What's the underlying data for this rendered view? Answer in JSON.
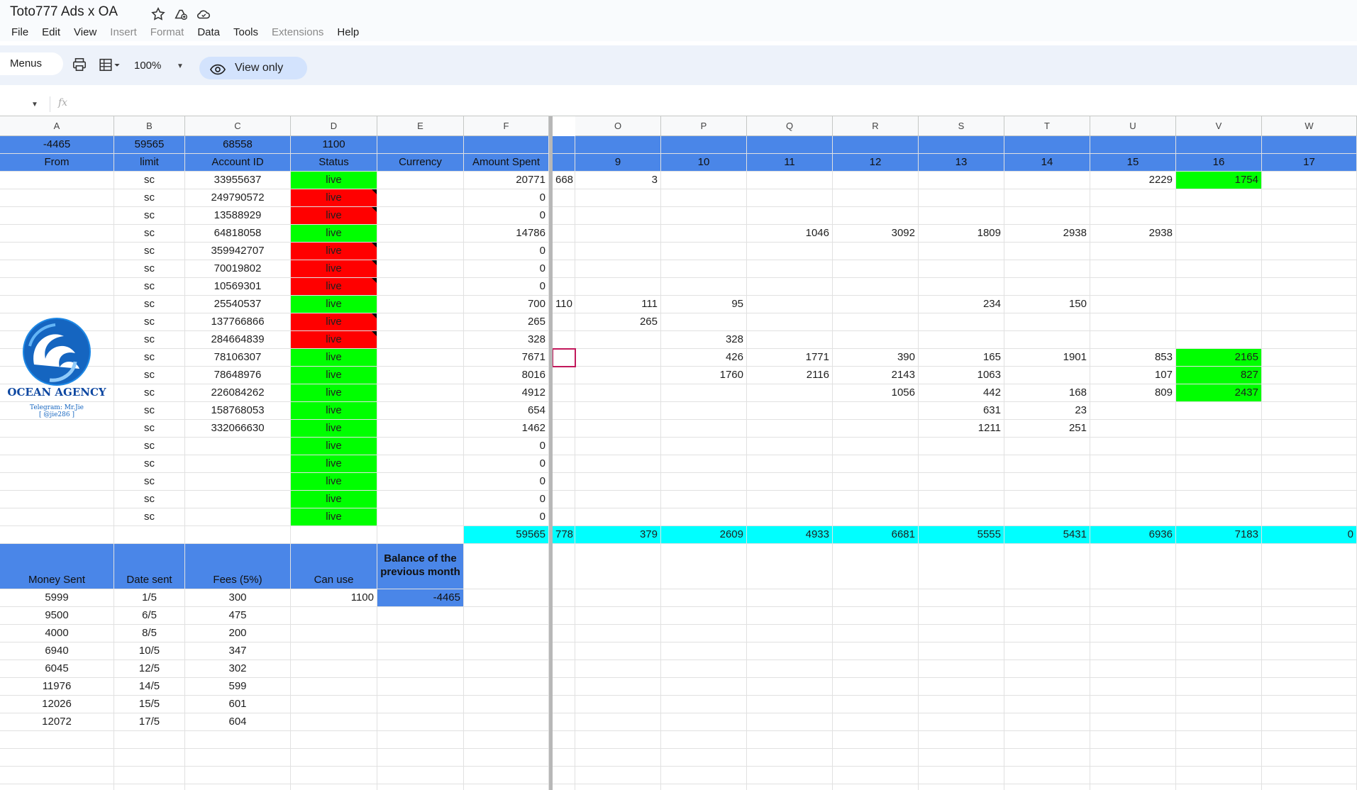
{
  "title": "Toto777 Ads x OA",
  "menus": [
    "File",
    "Edit",
    "View",
    "Insert",
    "Format",
    "Data",
    "Tools",
    "Extensions",
    "Help"
  ],
  "menus_disabled": [
    "Insert",
    "Format",
    "Extensions"
  ],
  "toolbar": {
    "menus_label": "Menus",
    "zoom": "100%",
    "view_only": "View only"
  },
  "formula_bar": {
    "fx": "fx",
    "value": ""
  },
  "columns": [
    "A",
    "B",
    "C",
    "D",
    "E",
    "F",
    "O",
    "P",
    "Q",
    "R",
    "S",
    "T",
    "U",
    "V",
    "W"
  ],
  "summary_row": [
    "-4465",
    "59565",
    "68558",
    "1100",
    "",
    ""
  ],
  "header_row": {
    "left": [
      "From",
      "limit",
      "Account ID",
      "Status",
      "Currency",
      "Amount Spent"
    ],
    "days": [
      "",
      "9",
      "10",
      "11",
      "12",
      "13",
      "14",
      "15",
      "16",
      "17"
    ]
  },
  "accounts": [
    {
      "limit": "sc",
      "id": "33955637",
      "status": "live",
      "status_color": "#00ff00",
      "spent": "20771",
      "n": "668",
      "days": [
        "3",
        "",
        "",
        "",
        "",
        "",
        "2229",
        "1754",
        ""
      ]
    },
    {
      "limit": "sc",
      "id": "249790572",
      "status": "live",
      "status_color": "#ff0000",
      "spent": "0",
      "n": "",
      "days": [
        "",
        "",
        "",
        "",
        "",
        "",
        "",
        "",
        ""
      ]
    },
    {
      "limit": "sc",
      "id": "13588929",
      "status": "live",
      "status_color": "#ff0000",
      "spent": "0",
      "n": "",
      "days": [
        "",
        "",
        "",
        "",
        "",
        "",
        "",
        "",
        ""
      ]
    },
    {
      "limit": "sc",
      "id": "64818058",
      "status": "live",
      "status_color": "#00ff00",
      "spent": "14786",
      "n": "",
      "days": [
        "",
        "",
        "1046",
        "3092",
        "1809",
        "2938",
        "2938",
        "",
        ""
      ]
    },
    {
      "limit": "sc",
      "id": "359942707",
      "status": "live",
      "status_color": "#ff0000",
      "spent": "0",
      "n": "",
      "days": [
        "",
        "",
        "",
        "",
        "",
        "",
        "",
        "",
        ""
      ]
    },
    {
      "limit": "sc",
      "id": "70019802",
      "status": "live",
      "status_color": "#ff0000",
      "spent": "0",
      "n": "",
      "days": [
        "",
        "",
        "",
        "",
        "",
        "",
        "",
        "",
        ""
      ]
    },
    {
      "limit": "sc",
      "id": "10569301",
      "status": "live",
      "status_color": "#ff0000",
      "spent": "0",
      "n": "",
      "days": [
        "",
        "",
        "",
        "",
        "",
        "",
        "",
        "",
        ""
      ]
    },
    {
      "limit": "sc",
      "id": "25540537",
      "status": "live",
      "status_color": "#00ff00",
      "spent": "700",
      "n": "110",
      "days": [
        "111",
        "95",
        "",
        "",
        "234",
        "150",
        "",
        "",
        ""
      ]
    },
    {
      "limit": "sc",
      "id": "137766866",
      "status": "live",
      "status_color": "#ff0000",
      "spent": "265",
      "n": "",
      "days": [
        "265",
        "",
        "",
        "",
        "",
        "",
        "",
        "",
        ""
      ]
    },
    {
      "limit": "sc",
      "id": "284664839",
      "status": "live",
      "status_color": "#ff0000",
      "spent": "328",
      "n": "",
      "days": [
        "",
        "328",
        "",
        "",
        "",
        "",
        "",
        "",
        ""
      ]
    },
    {
      "limit": "sc",
      "id": "78106307",
      "status": "live",
      "status_color": "#00ff00",
      "spent": "7671",
      "n": "",
      "days": [
        "",
        "426",
        "1771",
        "390",
        "165",
        "1901",
        "853",
        "2165",
        ""
      ]
    },
    {
      "limit": "sc",
      "id": "78648976",
      "status": "live",
      "status_color": "#00ff00",
      "spent": "8016",
      "n": "",
      "days": [
        "",
        "1760",
        "2116",
        "2143",
        "1063",
        "",
        "107",
        "827",
        ""
      ]
    },
    {
      "limit": "sc",
      "id": "226084262",
      "status": "live",
      "status_color": "#00ff00",
      "spent": "4912",
      "n": "",
      "days": [
        "",
        "",
        "",
        "1056",
        "442",
        "168",
        "809",
        "2437",
        ""
      ]
    },
    {
      "limit": "sc",
      "id": "158768053",
      "status": "live",
      "status_color": "#00ff00",
      "spent": "654",
      "n": "",
      "days": [
        "",
        "",
        "",
        "",
        "631",
        "23",
        "",
        "",
        ""
      ]
    },
    {
      "limit": "sc",
      "id": "332066630",
      "status": "live",
      "status_color": "#00ff00",
      "spent": "1462",
      "n": "",
      "days": [
        "",
        "",
        "",
        "",
        "1211",
        "251",
        "",
        "",
        ""
      ]
    },
    {
      "limit": "sc",
      "id": "",
      "status": "live",
      "status_color": "#00ff00",
      "spent": "0",
      "n": "",
      "days": [
        "",
        "",
        "",
        "",
        "",
        "",
        "",
        "",
        ""
      ]
    },
    {
      "limit": "sc",
      "id": "",
      "status": "live",
      "status_color": "#00ff00",
      "spent": "0",
      "n": "",
      "days": [
        "",
        "",
        "",
        "",
        "",
        "",
        "",
        "",
        ""
      ]
    },
    {
      "limit": "sc",
      "id": "",
      "status": "live",
      "status_color": "#00ff00",
      "spent": "0",
      "n": "",
      "days": [
        "",
        "",
        "",
        "",
        "",
        "",
        "",
        "",
        ""
      ]
    },
    {
      "limit": "sc",
      "id": "",
      "status": "live",
      "status_color": "#00ff00",
      "spent": "0",
      "n": "",
      "days": [
        "",
        "",
        "",
        "",
        "",
        "",
        "",
        "",
        ""
      ]
    },
    {
      "limit": "sc",
      "id": "",
      "status": "live",
      "status_color": "#00ff00",
      "spent": "0",
      "n": "",
      "days": [
        "",
        "",
        "",
        "",
        "",
        "",
        "",
        "",
        ""
      ]
    }
  ],
  "green_day_cells": [
    [
      0,
      7
    ],
    [
      10,
      7
    ],
    [
      11,
      7
    ],
    [
      12,
      7
    ]
  ],
  "totals_row": {
    "spent": "59565",
    "n": "778",
    "days": [
      "379",
      "2609",
      "4933",
      "6681",
      "5555",
      "5431",
      "6936",
      "7183",
      "0"
    ]
  },
  "payments_header": [
    "Money Sent",
    "Date sent",
    "Fees (5%)",
    "Can use",
    "Balance of the previous month"
  ],
  "payments": [
    {
      "money": "5999",
      "date": "1/5",
      "fee": "300"
    },
    {
      "money": "9500",
      "date": "6/5",
      "fee": "475"
    },
    {
      "money": "4000",
      "date": "8/5",
      "fee": "200"
    },
    {
      "money": "6940",
      "date": "10/5",
      "fee": "347"
    },
    {
      "money": "6045",
      "date": "12/5",
      "fee": "302"
    },
    {
      "money": "11976",
      "date": "14/5",
      "fee": "599"
    },
    {
      "money": "12026",
      "date": "15/5",
      "fee": "601"
    },
    {
      "money": "12072",
      "date": "17/5",
      "fee": "604"
    }
  ],
  "can_use": "1100",
  "balance_prev": "-4465",
  "logo": {
    "name": "OCEAN AGENCY",
    "telegram": "Telegram: Mr.Jie",
    "handle": "[ @jie286 ]"
  },
  "colors": {
    "header_blue": "#4a86e8",
    "total_cyan": "#00ffff",
    "live_green": "#00ff00",
    "dead_red": "#ff0000"
  }
}
